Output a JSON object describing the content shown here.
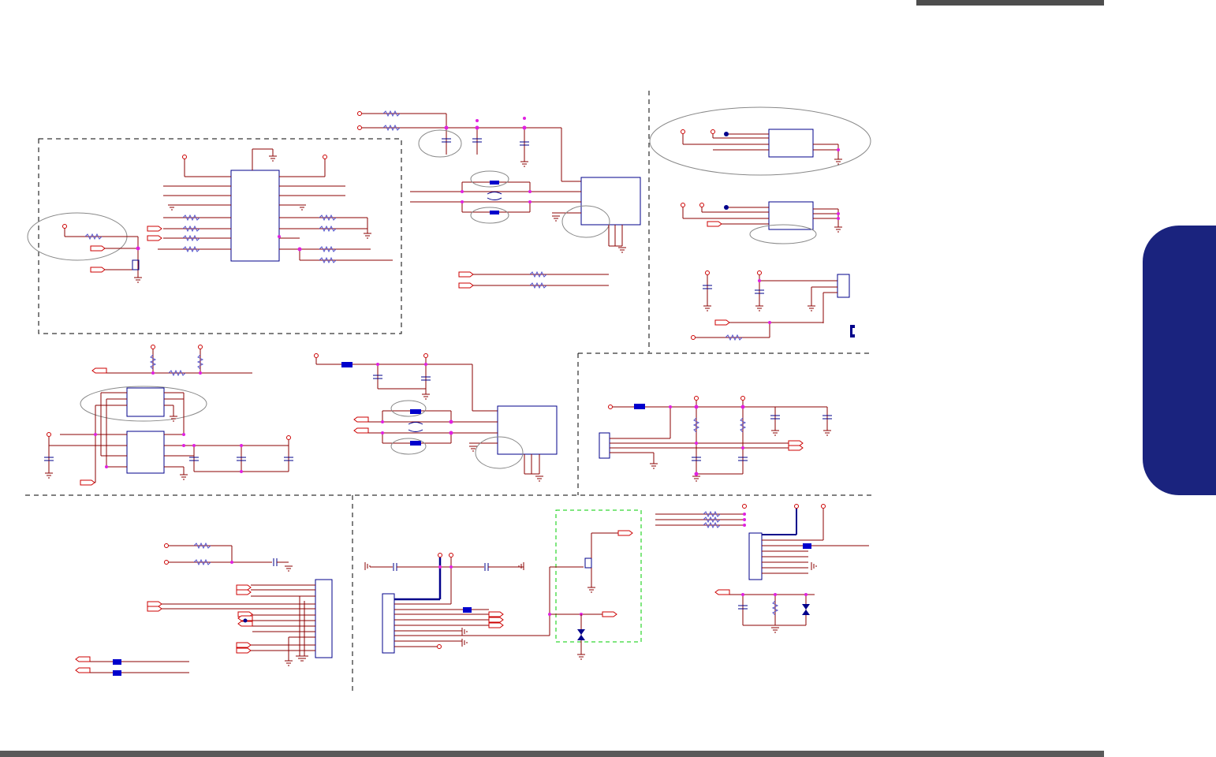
{
  "page": {
    "header_bar_color": "#4d4d4d",
    "footer_bar_color": "#5a5a5a",
    "side_tab_color": "#1a237e"
  },
  "schematic": {
    "wire_color": "#8b0000",
    "component_color": "#00008b",
    "junction_color": "#e020e0",
    "ferrite_color": "#0000cc",
    "highlight_color": "#00cc00",
    "divider_color": "#000000",
    "annotation_ellipse_color": "#888888",
    "sections": [
      "top-left-block",
      "top-middle-block",
      "top-right-block",
      "middle-left-block",
      "middle-center-block",
      "middle-right-block",
      "bottom-left-block",
      "bottom-center-block",
      "bottom-right-block"
    ]
  }
}
